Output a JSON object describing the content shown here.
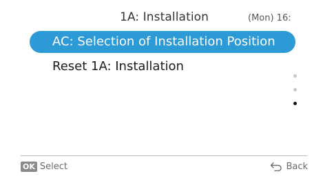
{
  "header": {
    "title": "1A: Installation",
    "clock": "(Mon) 16:"
  },
  "menu": {
    "items": [
      {
        "label": "AC: Selection of Installation Position",
        "selected": true
      },
      {
        "label": "Reset 1A: Installation",
        "selected": false
      }
    ]
  },
  "scroll_indicator": {
    "pages": 3,
    "current_page": 3
  },
  "footer": {
    "ok_badge": "OK",
    "select_label": "Select",
    "back_label": "Back",
    "back_icon": "back-arrow-icon"
  },
  "colors": {
    "accent": "#2b9ad7",
    "badge": "#8a8a8a"
  }
}
